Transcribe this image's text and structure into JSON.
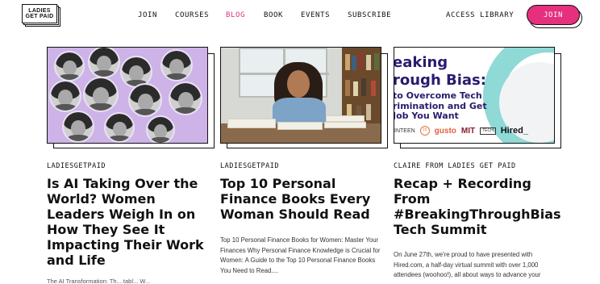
{
  "header": {
    "logo_lines": [
      "LADIES",
      "GET PAID"
    ],
    "nav": [
      {
        "label": "JOIN",
        "active": false
      },
      {
        "label": "COURSES",
        "active": false
      },
      {
        "label": "BLOG",
        "active": true
      },
      {
        "label": "BOOK",
        "active": false
      },
      {
        "label": "EVENTS",
        "active": false
      },
      {
        "label": "SUBSCRIBE",
        "active": false
      }
    ],
    "access_label": "ACCESS LIBRARY",
    "join_button": "JOIN"
  },
  "colors": {
    "accent_pink": "#e6307e",
    "active_nav": "#e0317e",
    "card1_bg": "#cdb3e8",
    "banner_navy": "#2b1a6e",
    "banner_teal": "#8fd9d6"
  },
  "cards": [
    {
      "author": "LADIESGETPAID",
      "title": "Is AI Taking Over the World? Women Leaders Weigh In on How They See It Impacting Their Work and Life",
      "excerpt": "",
      "cutoff": "The AI Transformation: Th... tabl... W..."
    },
    {
      "author": "LADIESGETPAID",
      "title": "Top 10 Personal Finance Books Every Woman Should Read",
      "excerpt": "Top 10 Personal Finance Books for Women: Master Your Finances Why Personal Finance Knowledge is Crucial for Women: A Guide to the Top 10 Personal Finance Books You Need to Read...."
    },
    {
      "author": "CLAIRE FROM LADIES GET PAID",
      "title": "Recap + Recording From #BreakingThroughBias Tech Summit",
      "excerpt": "On June 27th, we're proud to have presented with Hired.com, a half-day virtual summit with over 1,000 attendees (woohoo!), all about ways to advance your",
      "banner": {
        "headline_lines": [
          "eaking",
          "rough Bias:"
        ],
        "sub_lines": [
          "to Overcome Tech",
          "rimination and Get",
          "Job You Want"
        ],
        "sponsors": [
          "INTEEN",
          "15",
          "gusto",
          "MIT",
          "TECH",
          "Hired_"
        ]
      }
    }
  ]
}
